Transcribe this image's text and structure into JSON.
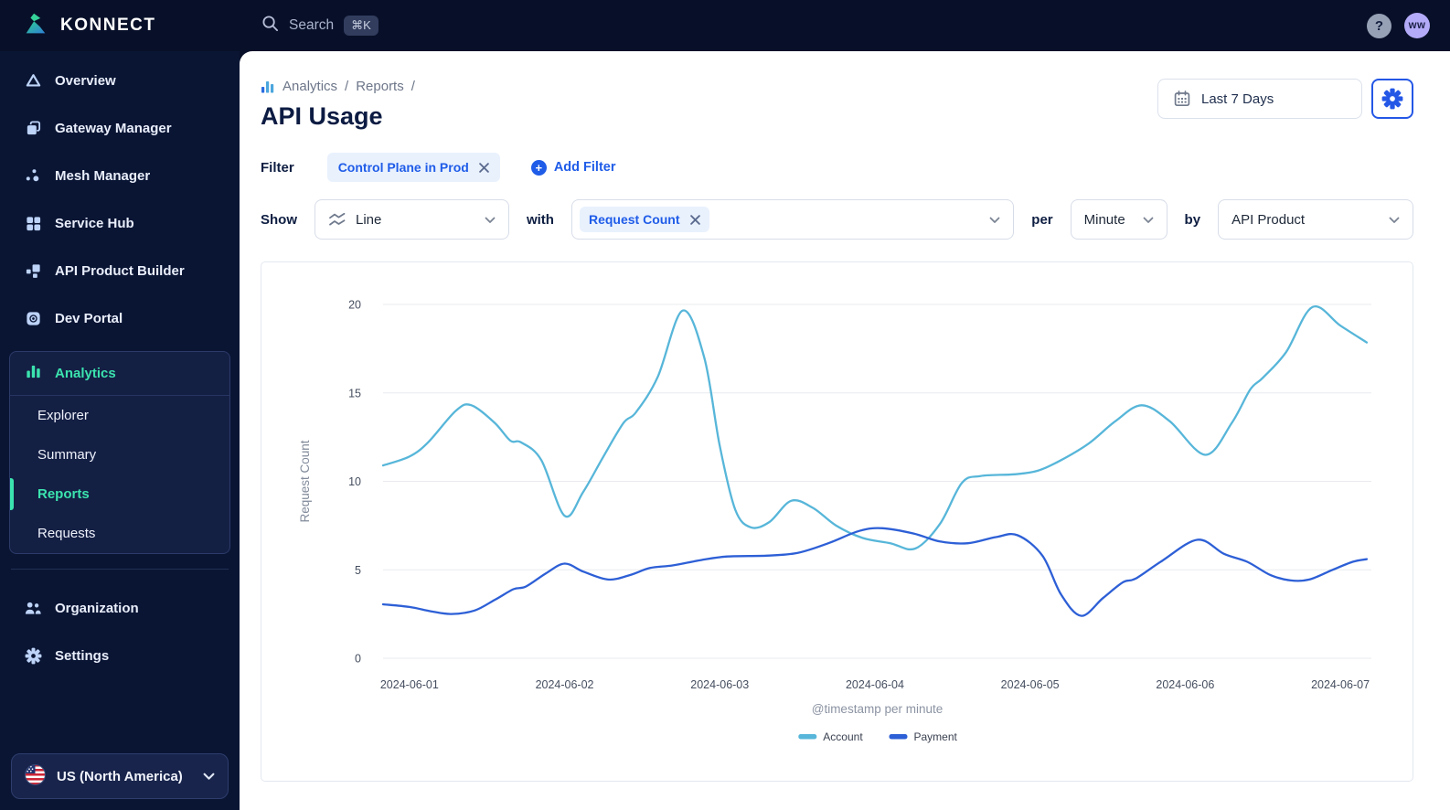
{
  "colors": {
    "accent_teal": "#3be3ae",
    "primary_blue": "#2457e6",
    "link_blue": "#1f5ce8",
    "series_account": "#57b6d9",
    "series_payment": "#2d5fd6",
    "topbar_bg": "#081029",
    "sidebar_bg": "#0a1534"
  },
  "topbar": {
    "brand": "KONNECT",
    "search_placeholder": "Search",
    "search_shortcut": "⌘K",
    "help_label": "?",
    "avatar_initials": "ww"
  },
  "sidebar": {
    "items": [
      {
        "label": "Overview"
      },
      {
        "label": "Gateway Manager"
      },
      {
        "label": "Mesh Manager"
      },
      {
        "label": "Service Hub"
      },
      {
        "label": "API Product Builder"
      },
      {
        "label": "Dev Portal"
      }
    ],
    "analytics": {
      "label": "Analytics",
      "subitems": [
        {
          "label": "Explorer"
        },
        {
          "label": "Summary"
        },
        {
          "label": "Reports"
        },
        {
          "label": "Requests"
        }
      ],
      "active_subitem": "Reports"
    },
    "footer_items": [
      {
        "label": "Organization"
      },
      {
        "label": "Settings"
      }
    ],
    "region": {
      "label": "US (North America)"
    }
  },
  "header": {
    "breadcrumb": {
      "items": [
        {
          "label": "Analytics"
        },
        {
          "label": "Reports"
        }
      ],
      "separator": "/"
    },
    "title": "API Usage",
    "date_range": "Last 7 Days"
  },
  "filter_bar": {
    "label": "Filter",
    "chips": [
      {
        "label": "Control Plane in Prod",
        "removable": true
      }
    ],
    "add_label": "Add Filter"
  },
  "query_bar": {
    "show_label": "Show",
    "chart_type": "Line",
    "with_label": "with",
    "metrics": [
      {
        "label": "Request Count",
        "removable": true
      }
    ],
    "per_label": "per",
    "granularity": "Minute",
    "by_label": "by",
    "group_by": "API Product"
  },
  "chart_data": {
    "type": "line",
    "title": "",
    "xlabel": "@timestamp per minute",
    "ylabel": "Request Count",
    "ylim": [
      0,
      20
    ],
    "yticks": [
      0,
      5,
      10,
      15,
      20
    ],
    "xticks": [
      "2024-06-01",
      "2024-06-02",
      "2024-06-03",
      "2024-06-04",
      "2024-06-05",
      "2024-06-06",
      "2024-06-07"
    ],
    "x_domain_days": [
      -0.17,
      6.2
    ],
    "grid": true,
    "legend_position": "bottom",
    "series": [
      {
        "name": "Account",
        "color": "#57b6d9",
        "points": [
          [
            -0.17,
            10.9
          ],
          [
            0,
            11.4
          ],
          [
            0.12,
            12.2
          ],
          [
            0.3,
            14.0
          ],
          [
            0.4,
            14.3
          ],
          [
            0.55,
            13.3
          ],
          [
            0.65,
            12.3
          ],
          [
            0.72,
            12.2
          ],
          [
            0.85,
            11.2
          ],
          [
            1.0,
            8.05
          ],
          [
            1.12,
            9.4
          ],
          [
            1.25,
            11.4
          ],
          [
            1.38,
            13.3
          ],
          [
            1.46,
            13.9
          ],
          [
            1.6,
            15.9
          ],
          [
            1.76,
            19.65
          ],
          [
            1.9,
            17.0
          ],
          [
            2.0,
            12.0
          ],
          [
            2.1,
            8.4
          ],
          [
            2.2,
            7.4
          ],
          [
            2.32,
            7.7
          ],
          [
            2.46,
            8.9
          ],
          [
            2.6,
            8.5
          ],
          [
            2.75,
            7.5
          ],
          [
            2.92,
            6.8
          ],
          [
            3.1,
            6.5
          ],
          [
            3.26,
            6.2
          ],
          [
            3.42,
            7.6
          ],
          [
            3.56,
            9.9
          ],
          [
            3.68,
            10.3
          ],
          [
            3.9,
            10.4
          ],
          [
            4.05,
            10.6
          ],
          [
            4.2,
            11.2
          ],
          [
            4.38,
            12.15
          ],
          [
            4.55,
            13.4
          ],
          [
            4.72,
            14.3
          ],
          [
            4.9,
            13.4
          ],
          [
            5.13,
            11.5
          ],
          [
            5.3,
            13.3
          ],
          [
            5.42,
            15.2
          ],
          [
            5.5,
            15.85
          ],
          [
            5.65,
            17.3
          ],
          [
            5.82,
            19.85
          ],
          [
            6.0,
            18.8
          ],
          [
            6.17,
            17.85
          ]
        ]
      },
      {
        "name": "Payment",
        "color": "#2d5fd6",
        "points": [
          [
            -0.17,
            3.05
          ],
          [
            0,
            2.9
          ],
          [
            0.14,
            2.65
          ],
          [
            0.27,
            2.5
          ],
          [
            0.42,
            2.7
          ],
          [
            0.55,
            3.3
          ],
          [
            0.67,
            3.9
          ],
          [
            0.75,
            4.05
          ],
          [
            0.88,
            4.8
          ],
          [
            1.0,
            5.35
          ],
          [
            1.12,
            4.9
          ],
          [
            1.28,
            4.45
          ],
          [
            1.42,
            4.7
          ],
          [
            1.55,
            5.1
          ],
          [
            1.7,
            5.25
          ],
          [
            1.88,
            5.55
          ],
          [
            2.05,
            5.75
          ],
          [
            2.3,
            5.8
          ],
          [
            2.5,
            5.95
          ],
          [
            2.7,
            6.5
          ],
          [
            2.9,
            7.2
          ],
          [
            3.05,
            7.35
          ],
          [
            3.25,
            7.05
          ],
          [
            3.42,
            6.6
          ],
          [
            3.6,
            6.5
          ],
          [
            3.78,
            6.85
          ],
          [
            3.92,
            6.95
          ],
          [
            4.08,
            5.8
          ],
          [
            4.2,
            3.6
          ],
          [
            4.33,
            2.4
          ],
          [
            4.47,
            3.4
          ],
          [
            4.6,
            4.3
          ],
          [
            4.68,
            4.5
          ],
          [
            4.85,
            5.5
          ],
          [
            5.08,
            6.7
          ],
          [
            5.25,
            5.9
          ],
          [
            5.4,
            5.45
          ],
          [
            5.55,
            4.7
          ],
          [
            5.68,
            4.4
          ],
          [
            5.8,
            4.45
          ],
          [
            5.95,
            5.0
          ],
          [
            6.08,
            5.45
          ],
          [
            6.17,
            5.6
          ]
        ]
      }
    ]
  }
}
